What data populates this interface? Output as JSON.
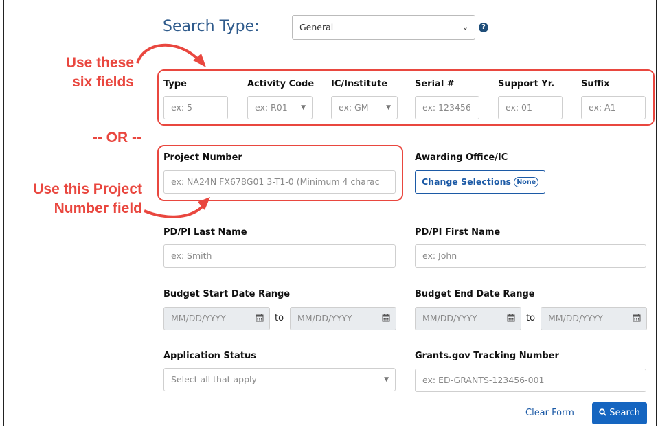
{
  "search_type": {
    "label": "Search Type:",
    "value": "General"
  },
  "annotations": {
    "six_fields": [
      "Use these",
      "six fields"
    ],
    "or": "-- OR --",
    "project_field": [
      "Use this Project",
      "Number field"
    ],
    "color": "#e9473f"
  },
  "grant_fields": [
    {
      "label": "Type",
      "placeholder": "ex: 5"
    },
    {
      "label": "Activity Code",
      "placeholder": "ex: R01"
    },
    {
      "label": "IC/Institute",
      "placeholder": "ex: GM"
    },
    {
      "label": "Serial #",
      "placeholder": "ex: 123456"
    },
    {
      "label": "Support Yr.",
      "placeholder": "ex: 01"
    },
    {
      "label": "Suffix",
      "placeholder": "ex: A1"
    }
  ],
  "project_number": {
    "label": "Project Number",
    "placeholder": "ex: NA24N FX678G01 3-T1-0 (Minimum 4 charac"
  },
  "awarding_office": {
    "label": "Awarding Office/IC",
    "button": "Change Selections",
    "badge": "None"
  },
  "pdpi_last": {
    "label": "PD/PI Last Name",
    "placeholder": "ex: Smith"
  },
  "pdpi_first": {
    "label": "PD/PI First Name",
    "placeholder": "ex: John"
  },
  "budget_start": {
    "label": "Budget Start Date Range",
    "from": "MM/DD/YYYY",
    "to_word": "to",
    "to": "MM/DD/YYYY"
  },
  "budget_end": {
    "label": "Budget End Date Range",
    "from": "MM/DD/YYYY",
    "to_word": "to",
    "to": "MM/DD/YYYY"
  },
  "app_status": {
    "label": "Application Status",
    "placeholder": "Select all that apply"
  },
  "grants_gov": {
    "label": "Grants.gov Tracking Number",
    "placeholder": "ex: ED-GRANTS-123456-001"
  },
  "actions": {
    "clear": "Clear Form",
    "search": "Search"
  },
  "colors": {
    "link": "#1c5aa6",
    "primary": "#1565c0",
    "accent_red": "#e9473f"
  }
}
